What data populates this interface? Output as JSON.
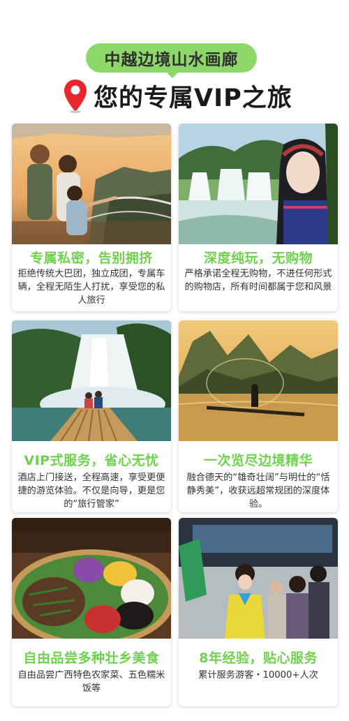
{
  "header": {
    "banner": "中越边境山水画廊",
    "title": "您的专属VIP之旅",
    "accent_color": "#8ed86a",
    "pin_color": "#e8262b",
    "pin_icon": "location-pin-icon"
  },
  "cards": [
    {
      "title": "专属私密，告别拥挤",
      "desc": "拒绝传统大巴团，独立成团，专属车辆，全程无陌生人打扰，享受您的私人旅行",
      "photo": "family-viewpoint-photo"
    },
    {
      "title": "深度纯玩，无购物",
      "desc": "严格承诺全程无购物，不进任何形式的购物店，所有时间都属于您和风景",
      "photo": "waterfall-portrait-photo"
    },
    {
      "title": "VIP式服务，省心无忧",
      "desc": "酒店上门接送，全程高速，享受更便捷的游览体验。不仅是向导，更是您的“旅行管家”",
      "photo": "bamboo-raft-waterfall-photo"
    },
    {
      "title": "一次览尽边境精华",
      "desc": "融合德天的“雄奇壮阔”与明仕的“恬静秀美”，收获远超常规团的深度体验。",
      "photo": "karst-river-fisherman-photo"
    },
    {
      "title": "自由品尝多种壮乡美食",
      "desc": "自由品尝广西特色农家菜、五色糯米饭等",
      "photo": "five-color-rice-photo"
    },
    {
      "title": "8年经验，贴心服务",
      "desc": "累计服务游客・10000+人次",
      "photo": "tour-guide-group-photo"
    }
  ]
}
